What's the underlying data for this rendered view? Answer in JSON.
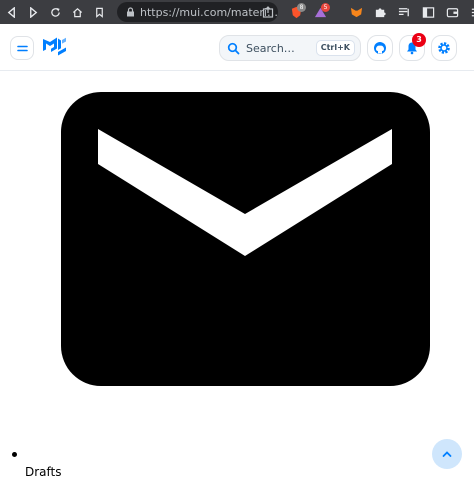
{
  "browser": {
    "url": "https://mui.com/materi…",
    "extensions": [
      {
        "name": "brave-shields",
        "badge": "8"
      },
      {
        "name": "brave-rewards",
        "badge": "5"
      }
    ]
  },
  "header": {
    "search_placeholder": "Search…",
    "search_shortcut": "Ctrl+K",
    "notifications_count": "3"
  },
  "main": {
    "list_item_label": "Drafts"
  },
  "colors": {
    "brand": "#007fff",
    "badge": "#eb0014",
    "chrome": "#3c3d41"
  }
}
